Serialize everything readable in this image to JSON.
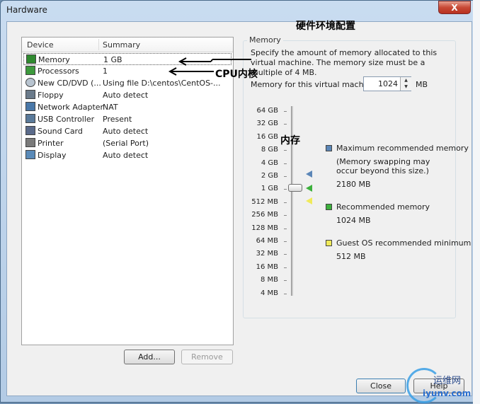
{
  "window": {
    "title": "Hardware",
    "close_label": "X"
  },
  "device_list": {
    "headers": {
      "device": "Device",
      "summary": "Summary"
    },
    "rows": [
      {
        "device": "Memory",
        "summary": "1 GB",
        "icon": "memory-icon"
      },
      {
        "device": "Processors",
        "summary": "1",
        "icon": "processor-icon"
      },
      {
        "device": "New CD/DVD (...",
        "summary": "Using file D:\\centos\\CentOS-...",
        "icon": "cd-dvd-icon"
      },
      {
        "device": "Floppy",
        "summary": "Auto detect",
        "icon": "floppy-icon"
      },
      {
        "device": "Network Adapter",
        "summary": "NAT",
        "icon": "network-adapter-icon"
      },
      {
        "device": "USB Controller",
        "summary": "Present",
        "icon": "usb-icon"
      },
      {
        "device": "Sound Card",
        "summary": "Auto detect",
        "icon": "sound-card-icon"
      },
      {
        "device": "Printer",
        "summary": "(Serial Port)",
        "icon": "printer-icon"
      },
      {
        "device": "Display",
        "summary": "Auto detect",
        "icon": "display-icon"
      }
    ],
    "selected_index": 0
  },
  "buttons": {
    "add": "Add...",
    "remove": "Remove",
    "close": "Close",
    "help": "Help"
  },
  "memory": {
    "group_title": "Memory",
    "description": "Specify the amount of memory allocated to this virtual machine. The memory size must be a multiple of 4 MB.",
    "field_label": "Memory for this virtual machine:",
    "value": "1024",
    "unit": "MB",
    "scale_labels": [
      "64 GB",
      "32 GB",
      "16 GB",
      "8 GB",
      "4 GB",
      "2 GB",
      "1 GB",
      "512 MB",
      "256 MB",
      "128 MB",
      "64 MB",
      "32 MB",
      "16 MB",
      "8 MB",
      "4 MB"
    ],
    "legend": {
      "max_title": "Maximum recommended memory",
      "max_note": "(Memory swapping may occur beyond this size.)",
      "max_value": "2180 MB",
      "rec_title": "Recommended memory",
      "rec_value": "1024 MB",
      "min_title": "Guest OS recommended minimum",
      "min_value": "512 MB"
    },
    "colors": {
      "max": "#5b86b7",
      "recommended": "#3cb03c",
      "minimum": "#f0ea5a"
    }
  },
  "annotations": {
    "top": "硬件环境配置",
    "cpu": "CPU内核",
    "memory": "内存"
  },
  "watermark": {
    "line1": "运维网",
    "line2": "iyunv.com"
  }
}
